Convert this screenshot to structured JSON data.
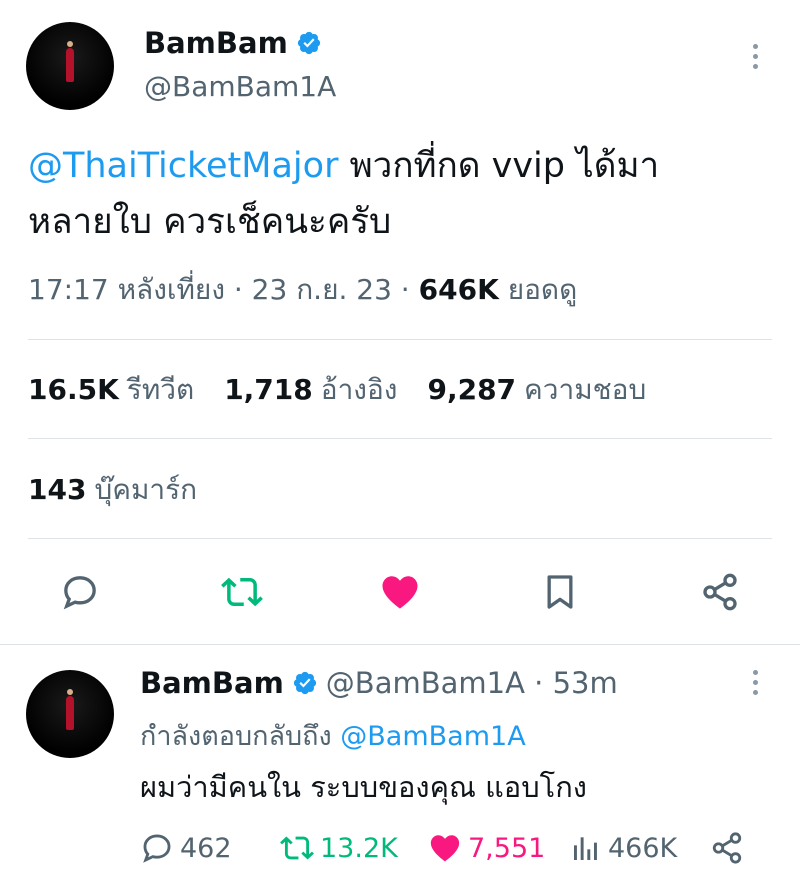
{
  "tweet": {
    "author_name": "BamBam",
    "author_handle": "@BamBam1A",
    "text_mention": "@ThaiTicketMajor",
    "text_line1_rest": " พวกที่กด vvip ได้มา",
    "text_line2": "หลายใบ ควรเช็คนะครับ",
    "timestamp": "17:17 หลังเที่ยง · 23 ก.ย. 23 ·",
    "views_count": "646K",
    "views_label": "ยอดดู",
    "retweets_count": "16.5K",
    "retweets_label": "รีทวีต",
    "quotes_count": "1,718",
    "quotes_label": "อ้างอิง",
    "likes_count": "9,287",
    "likes_label": "ความชอบ",
    "bookmarks_count": "143",
    "bookmarks_label": "บุ๊คมาร์ก"
  },
  "reply": {
    "author_name": "BamBam",
    "author_handle": "@BamBam1A · 53m",
    "replying_prefix": "กำลังตอบกลับถึง ",
    "replying_to": "@BamBam1A",
    "text": "ผมว่ามีคนใน ระบบของคุณ แอบโกง",
    "reply_count": "462",
    "retweet_count": "13.2K",
    "like_count": "7,551",
    "view_count": "466K"
  },
  "colors": {
    "accent": "#1d9bf0",
    "retweet_green": "#00ba7c",
    "like_pink": "#f91880",
    "secondary_text": "#536471"
  }
}
